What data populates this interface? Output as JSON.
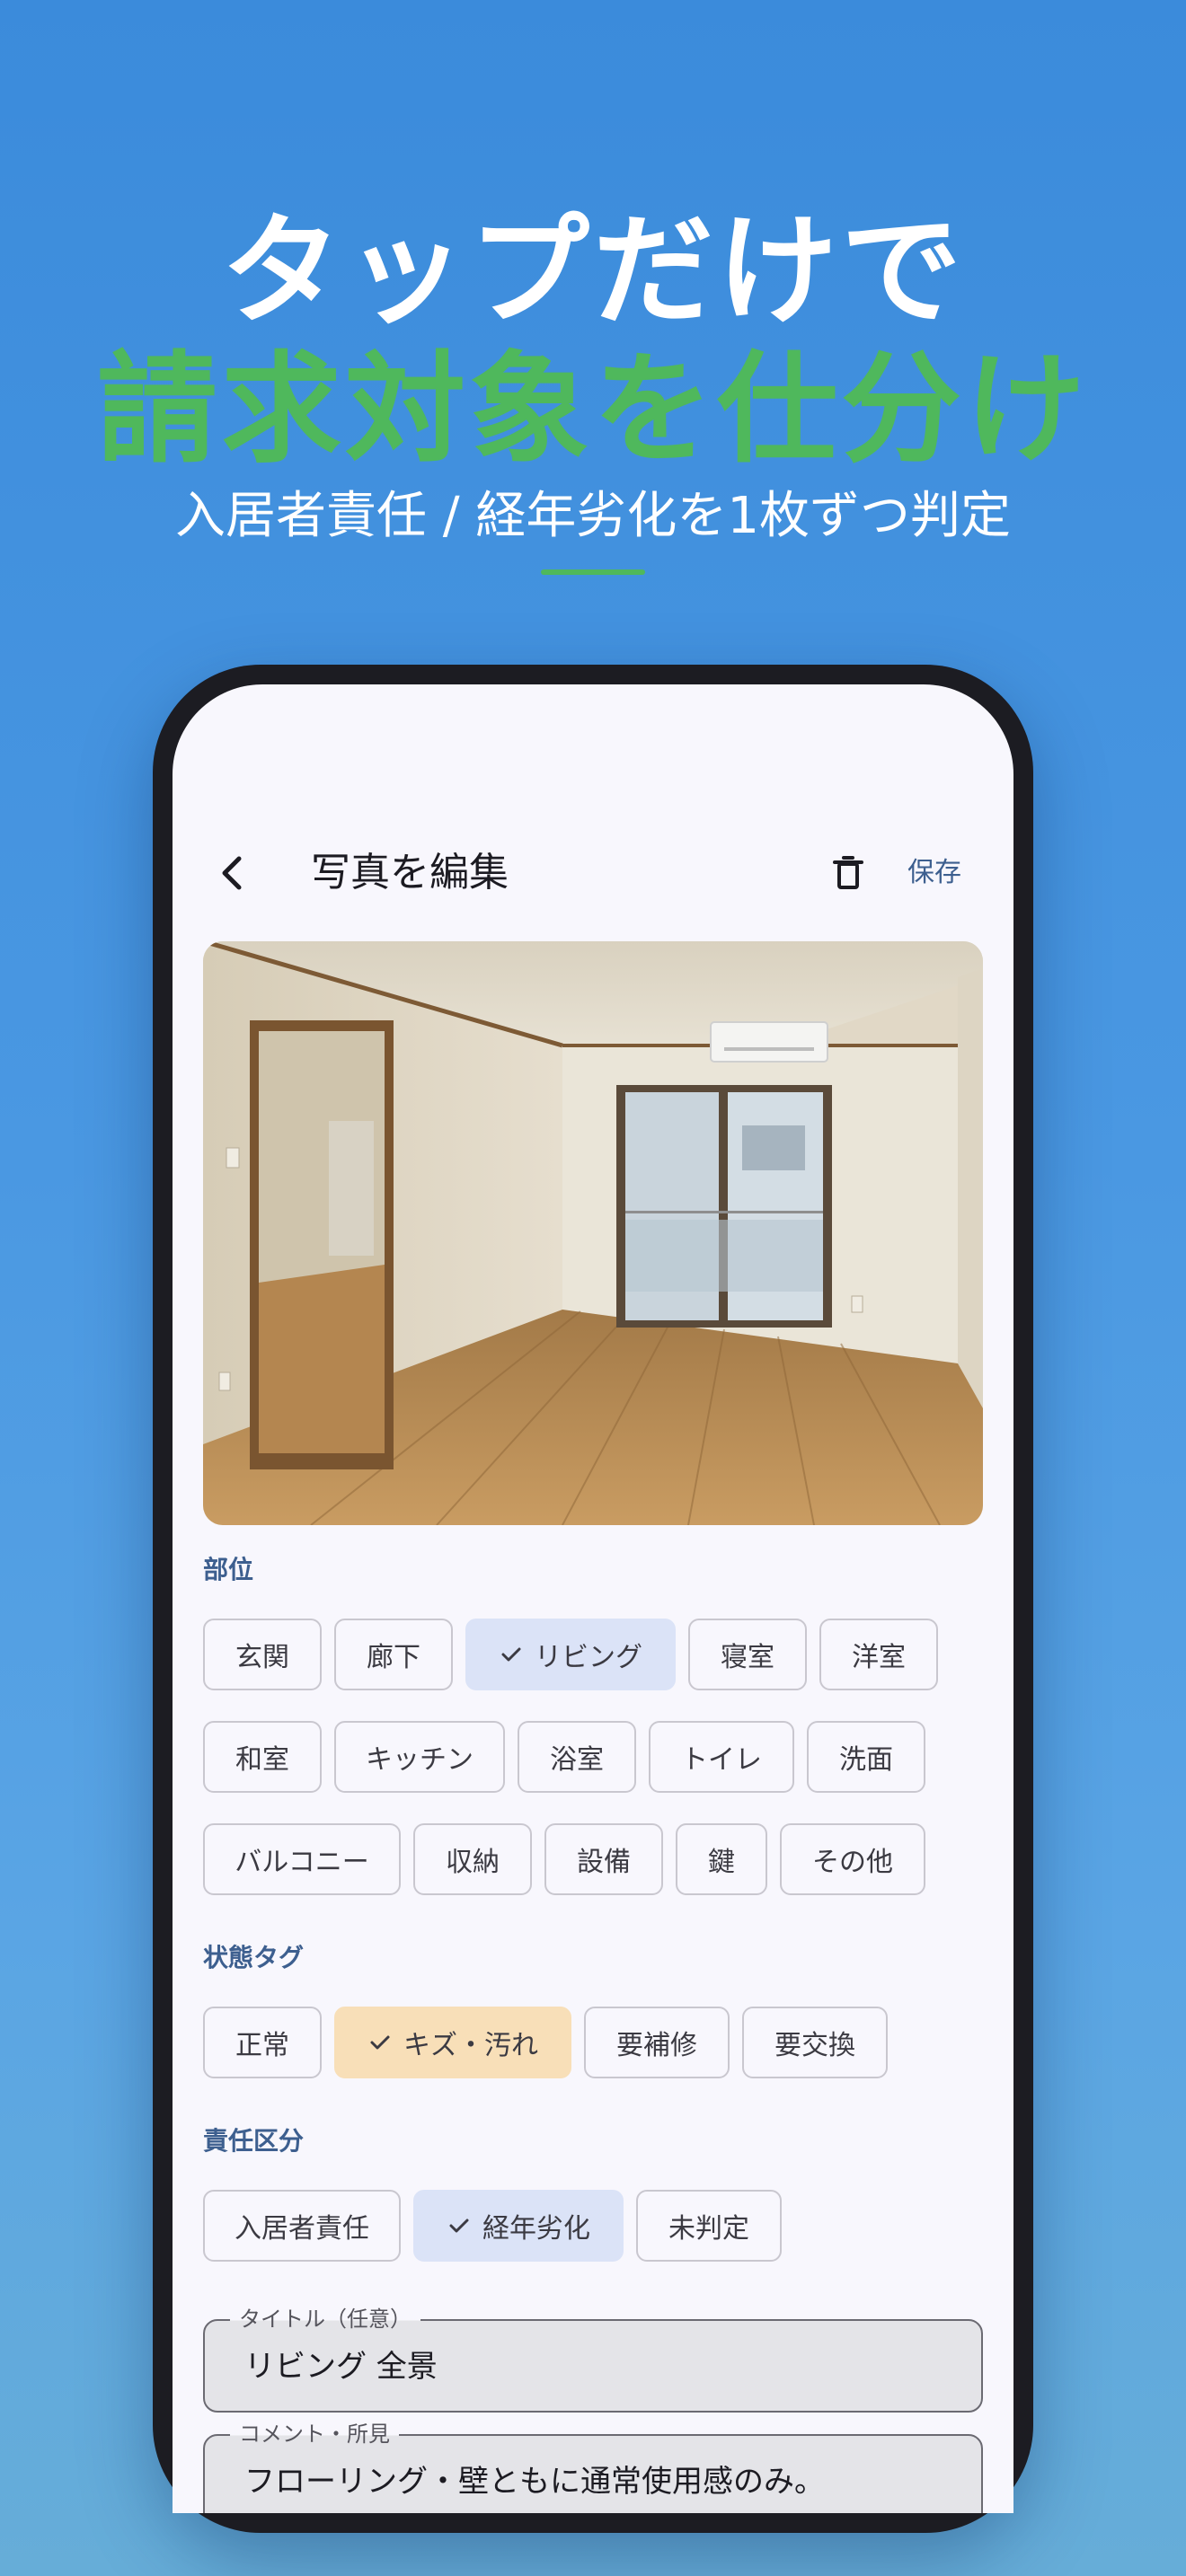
{
  "hero": {
    "line1": "タップだけで",
    "line2": "請求対象を仕分け",
    "subtitle": "入居者責任 / 経年劣化を1枚ずつ判定"
  },
  "appbar": {
    "title": "写真を編集",
    "save_label": "保存",
    "back_icon": "back-chevron-icon",
    "delete_icon": "trash-icon"
  },
  "photo": {
    "subject": "living-room-photo"
  },
  "location": {
    "label": "部位",
    "chips": [
      {
        "label": "玄関",
        "selected": false
      },
      {
        "label": "廊下",
        "selected": false
      },
      {
        "label": "リビング",
        "selected": true
      },
      {
        "label": "寝室",
        "selected": false
      },
      {
        "label": "洋室",
        "selected": false
      },
      {
        "label": "和室",
        "selected": false
      },
      {
        "label": "キッチン",
        "selected": false
      },
      {
        "label": "浴室",
        "selected": false
      },
      {
        "label": "トイレ",
        "selected": false
      },
      {
        "label": "洗面",
        "selected": false
      },
      {
        "label": "バルコニー",
        "selected": false
      },
      {
        "label": "収納",
        "selected": false
      },
      {
        "label": "設備",
        "selected": false
      },
      {
        "label": "鍵",
        "selected": false
      },
      {
        "label": "その他",
        "selected": false
      }
    ]
  },
  "condition": {
    "label": "状態タグ",
    "chips": [
      {
        "label": "正常",
        "selected": false
      },
      {
        "label": "キズ・汚れ",
        "selected": true
      },
      {
        "label": "要補修",
        "selected": false
      },
      {
        "label": "要交換",
        "selected": false
      }
    ]
  },
  "responsibility": {
    "label": "責任区分",
    "chips": [
      {
        "label": "入居者責任",
        "selected": false
      },
      {
        "label": "経年劣化",
        "selected": true
      },
      {
        "label": "未判定",
        "selected": false
      }
    ]
  },
  "fields": {
    "title_label": "タイトル（任意）",
    "title_value": "リビング 全景",
    "comment_label": "コメント・所見",
    "comment_value": "フローリング・壁ともに通常使用感のみ。"
  },
  "colors": {
    "background": "#4a98e2",
    "accent_green": "#4fb85c",
    "selected_blue": "#dbe3f7",
    "selected_orange": "#f8dfb8",
    "label_blue": "#3d5f8f"
  }
}
